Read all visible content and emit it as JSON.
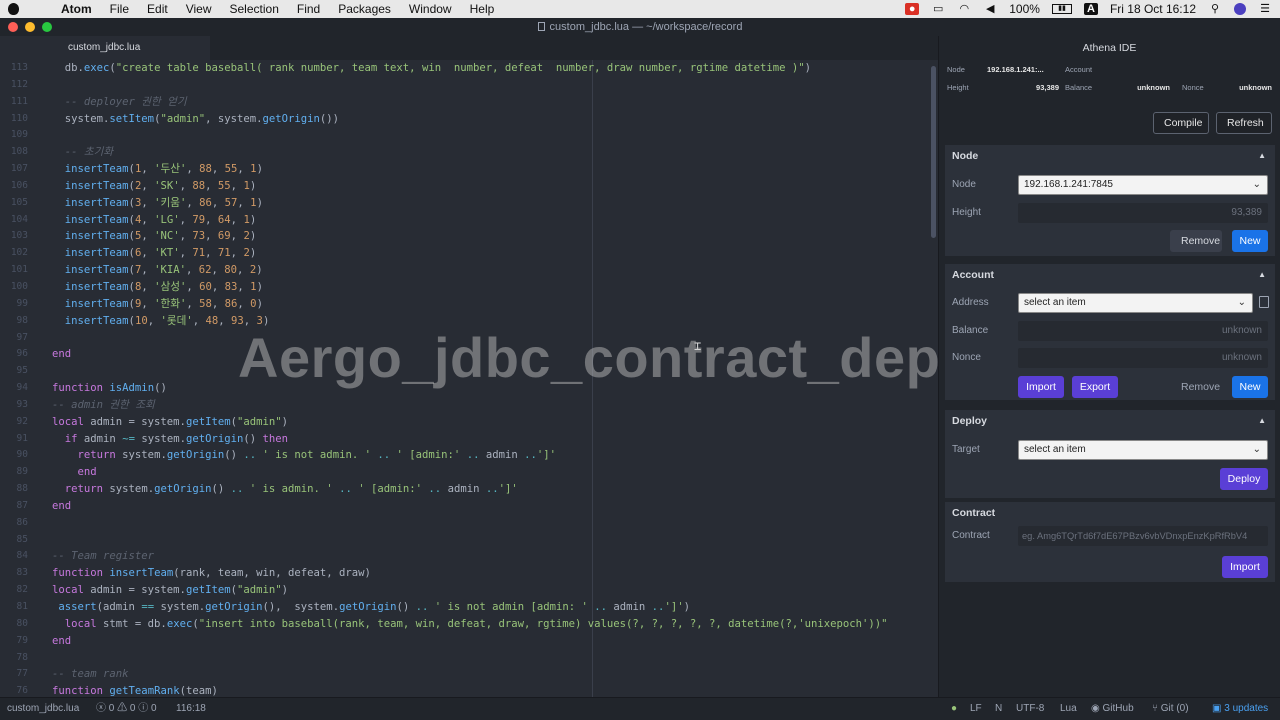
{
  "menubar": {
    "app": "Atom",
    "items": [
      "File",
      "Edit",
      "View",
      "Selection",
      "Find",
      "Packages",
      "Window",
      "Help"
    ],
    "battery": "100%",
    "keyboard": "A",
    "datetime": "Fri 18 Oct  16:12"
  },
  "window": {
    "title": "custom_jdbc.lua — ~/workspace/record"
  },
  "tab": {
    "label": "custom_jdbc.lua"
  },
  "editor": {
    "line_numbers": [
      "113",
      "112",
      "111",
      "110",
      "109",
      "108",
      "107",
      "106",
      "105",
      "104",
      "103",
      "102",
      "101",
      "100",
      "99",
      "98",
      "97",
      "96",
      "95",
      "94",
      "93",
      "92",
      "91",
      "90",
      "89",
      "88",
      "87",
      "86",
      "85",
      "84",
      "83",
      "82",
      "81",
      "80",
      "79",
      "78",
      "77",
      "76"
    ]
  },
  "watermark": "Aergo_jdbc_contract_deploy",
  "panel": {
    "title": "Athena IDE",
    "info": {
      "node_label": "Node",
      "node_value": "192.168.1.241:...",
      "account_label": "Account",
      "height_label": "Height",
      "height_value": "93,389",
      "balance_label": "Balance",
      "balance_value": "unknown",
      "nonce_label": "Nonce",
      "nonce_value": "unknown"
    },
    "compile_label": "Compile",
    "refresh_label": "Refresh",
    "node_section": {
      "title": "Node",
      "node_label": "Node",
      "node_value": "192.168.1.241:7845",
      "height_label": "Height",
      "height_value": "93,389",
      "remove_label": "Remove",
      "new_label": "New"
    },
    "account_section": {
      "title": "Account",
      "address_label": "Address",
      "address_value": "select an item",
      "balance_label": "Balance",
      "balance_value": "unknown",
      "nonce_label": "Nonce",
      "nonce_value": "unknown",
      "import_label": "Import",
      "export_label": "Export",
      "remove_label": "Remove",
      "new_label": "New"
    },
    "deploy_section": {
      "title": "Deploy",
      "target_label": "Target",
      "target_value": "select an item",
      "deploy_label": "Deploy"
    },
    "contract_section": {
      "title": "Contract",
      "contract_label": "Contract",
      "contract_placeholder": "eg. Amg6TQrTd6f7dE67PBzv6vbVDnxpEnzKpRfRbV4",
      "import_label": "Import"
    }
  },
  "statusbar": {
    "file": "custom_jdbc.lua",
    "diagnostics": "0 ⚠ 0 ⓘ 0",
    "position": "116:18",
    "line_ending": "LF",
    "indent": "N",
    "encoding": "UTF-8",
    "grammar": "Lua",
    "github": "GitHub",
    "git": "Git (0)",
    "updates": "3 updates"
  }
}
